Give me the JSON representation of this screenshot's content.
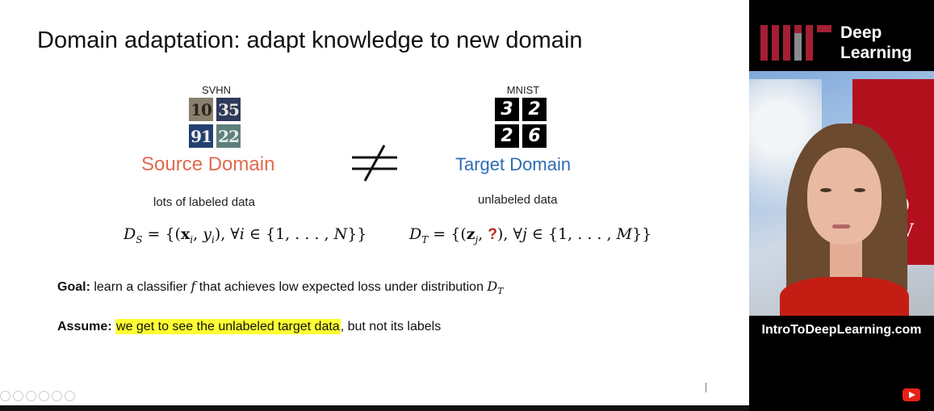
{
  "slide": {
    "title": "Domain adaptation: adapt knowledge to new domain",
    "source": {
      "caption": "SVHN",
      "digits": [
        "10",
        "35",
        "91",
        "22"
      ],
      "label": "Source Domain",
      "label_color": "#e06a4f",
      "description": "lots of labeled data"
    },
    "target": {
      "caption": "MNIST",
      "digits": [
        "3",
        "2",
        "2",
        "6"
      ],
      "label": "Target Domain",
      "label_color": "#2f6db5",
      "description": "unlabeled data"
    },
    "not_equal_symbol": "≠",
    "goal": {
      "label": "Goal:",
      "text_before": " learn a classifier ",
      "var_f": "f",
      "text_after": " that achieves low expected loss under distribution ",
      "dist": "D",
      "dist_sub": "T"
    },
    "assume": {
      "label": "Assume:",
      "highlight": "we get to see the unlabeled target data",
      "rest": ", but not its labels",
      "highlight_color": "#ffff33"
    }
  },
  "video": {
    "brand_line1": "Deep",
    "brand_line2": "Learning",
    "url": "IntroToDeepLearning.com",
    "building_sign_1": "BO",
    "building_sign_2": "NIV"
  },
  "colors": {
    "question_mark": "#c0221b",
    "youtube_red": "#e62117"
  }
}
